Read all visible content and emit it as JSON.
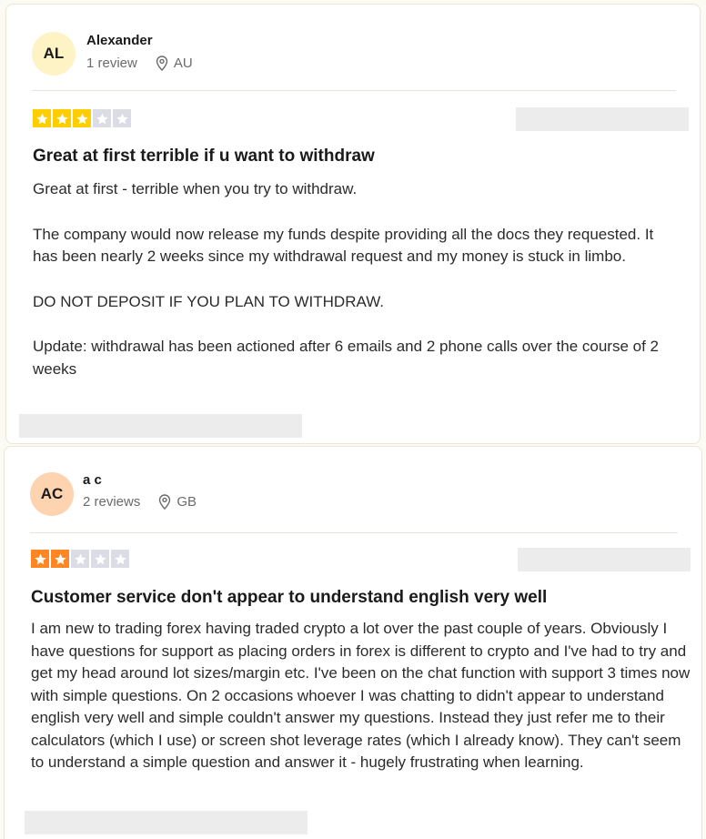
{
  "reviews": [
    {
      "initials": "AL",
      "avatar_color": "#fdf3c4",
      "name": "Alexander",
      "review_count": "1 review",
      "country": "AU",
      "rating": 3,
      "star_color": "#ffce00",
      "title": "Great at first terrible if u want to withdraw",
      "paragraphs": [
        "Great at first - terrible when you try to withdraw.",
        "The company would now release my funds despite providing all the docs they requested. It has been nearly 2 weeks since my withdrawal request and my money is stuck in limbo.",
        "DO NOT DEPOSIT IF YOU PLAN TO WITHDRAW.",
        "Update: withdrawal has been actioned after 6 emails and 2 phone calls over the course of 2 weeks"
      ]
    },
    {
      "initials": "AC",
      "avatar_color": "#fdd3b0",
      "name": "a c",
      "review_count": "2 reviews",
      "country": "GB",
      "rating": 2,
      "star_color": "#ff8622",
      "title": "Customer service don't appear to understand english very well",
      "paragraphs": [
        "I am new to trading forex having traded crypto a lot over the past couple of years. Obviously I have questions for support as placing orders in forex is different to crypto and I've had to try and get my head around lot sizes/margin etc. I've been on the chat function with support 3 times now with simple questions. On 2 occasions whoever I was chatting to didn't appear to understand english very well and simple couldn't answer my questions. Instead they just refer me to their calculators (which I use) or screen shot leverage rates (which I already know). They can't seem to understand a simple question and answer it - hugely frustrating when learning."
      ]
    }
  ]
}
